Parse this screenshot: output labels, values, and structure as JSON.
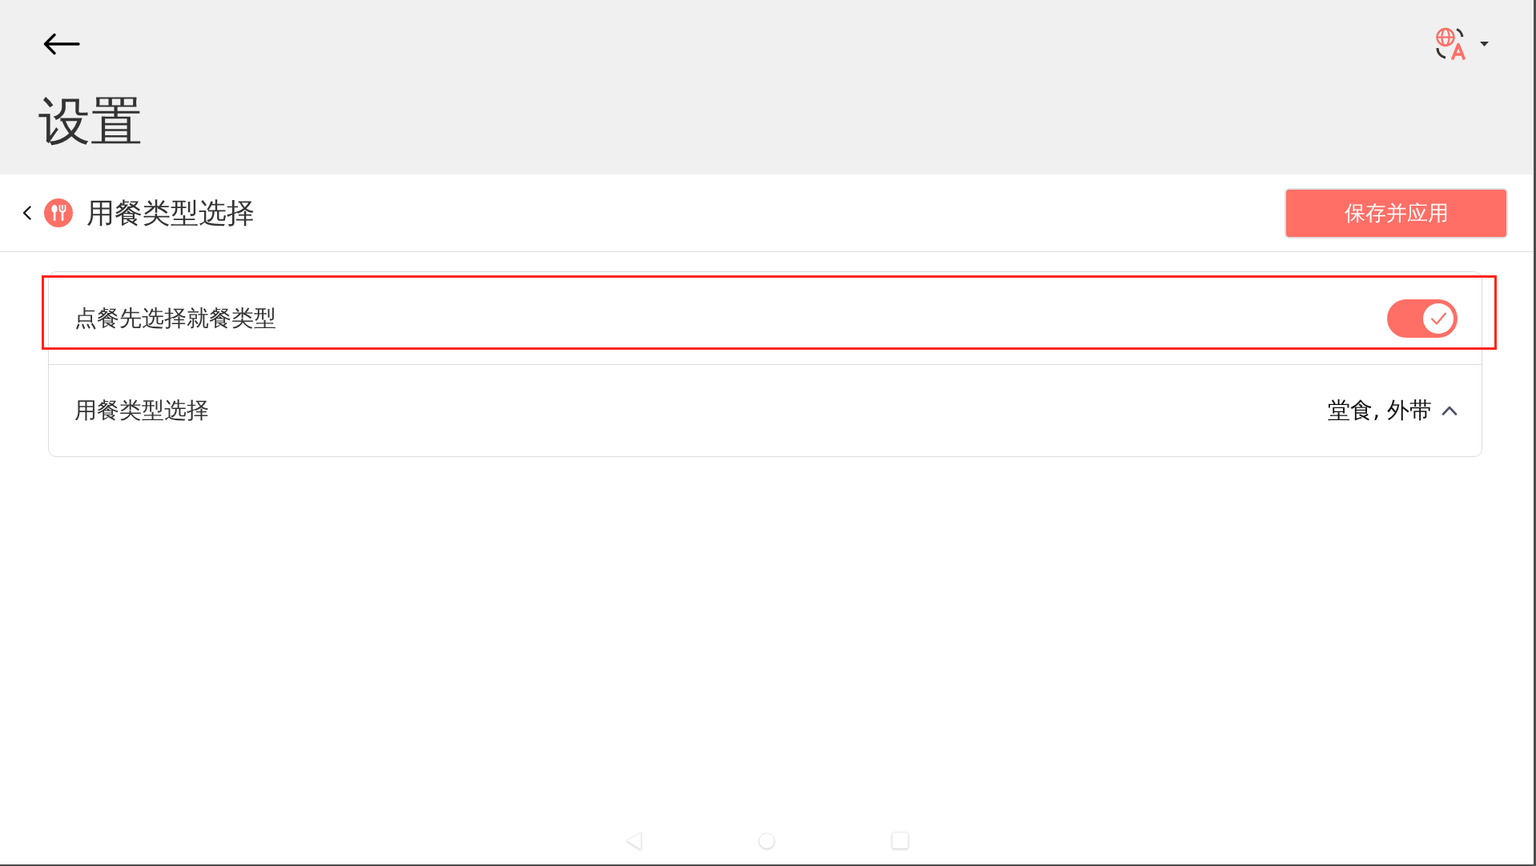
{
  "app_bar": {
    "title": "设置"
  },
  "section_header": {
    "title": "用餐类型选择",
    "save_button": "保存并应用"
  },
  "settings": [
    {
      "kind": "toggle",
      "label": "点餐先选择就餐类型",
      "on": true,
      "highlighted": true
    },
    {
      "kind": "select",
      "label": "用餐类型选择",
      "value": "堂食, 外带",
      "expanded": true,
      "highlighted": false
    }
  ]
}
